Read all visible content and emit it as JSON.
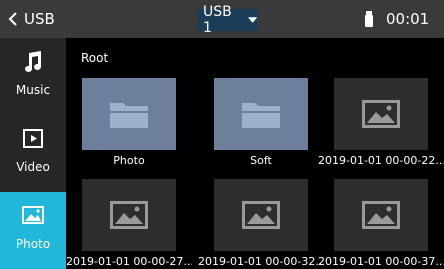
{
  "topbar": {
    "back_label": "USB",
    "device_label": "USB 1",
    "clock": "00:01"
  },
  "sidebar": {
    "items": [
      {
        "label": "Music",
        "icon": "music-note-icon",
        "active": false
      },
      {
        "label": "Video",
        "icon": "video-play-icon",
        "active": false
      },
      {
        "label": "Photo",
        "icon": "photo-icon",
        "active": true
      }
    ]
  },
  "content": {
    "path": "Root",
    "files": [
      {
        "name": "Photo",
        "kind": "folder"
      },
      {
        "name": "Soft",
        "kind": "folder"
      },
      {
        "name": "2019-01-01 00-00-22....",
        "kind": "image"
      },
      {
        "name": "2019-01-01 00-00-27....",
        "kind": "image"
      },
      {
        "name": "2019-01-01 00-00-32....",
        "kind": "image"
      },
      {
        "name": "2019-01-01 00-00-37....",
        "kind": "image"
      }
    ]
  },
  "colors": {
    "accent": "#21b7db",
    "folder_tile": "#6d7f9b",
    "image_tile": "#2e2e2e",
    "topbar": "#3a3a3a",
    "sidebar": "#262626"
  }
}
